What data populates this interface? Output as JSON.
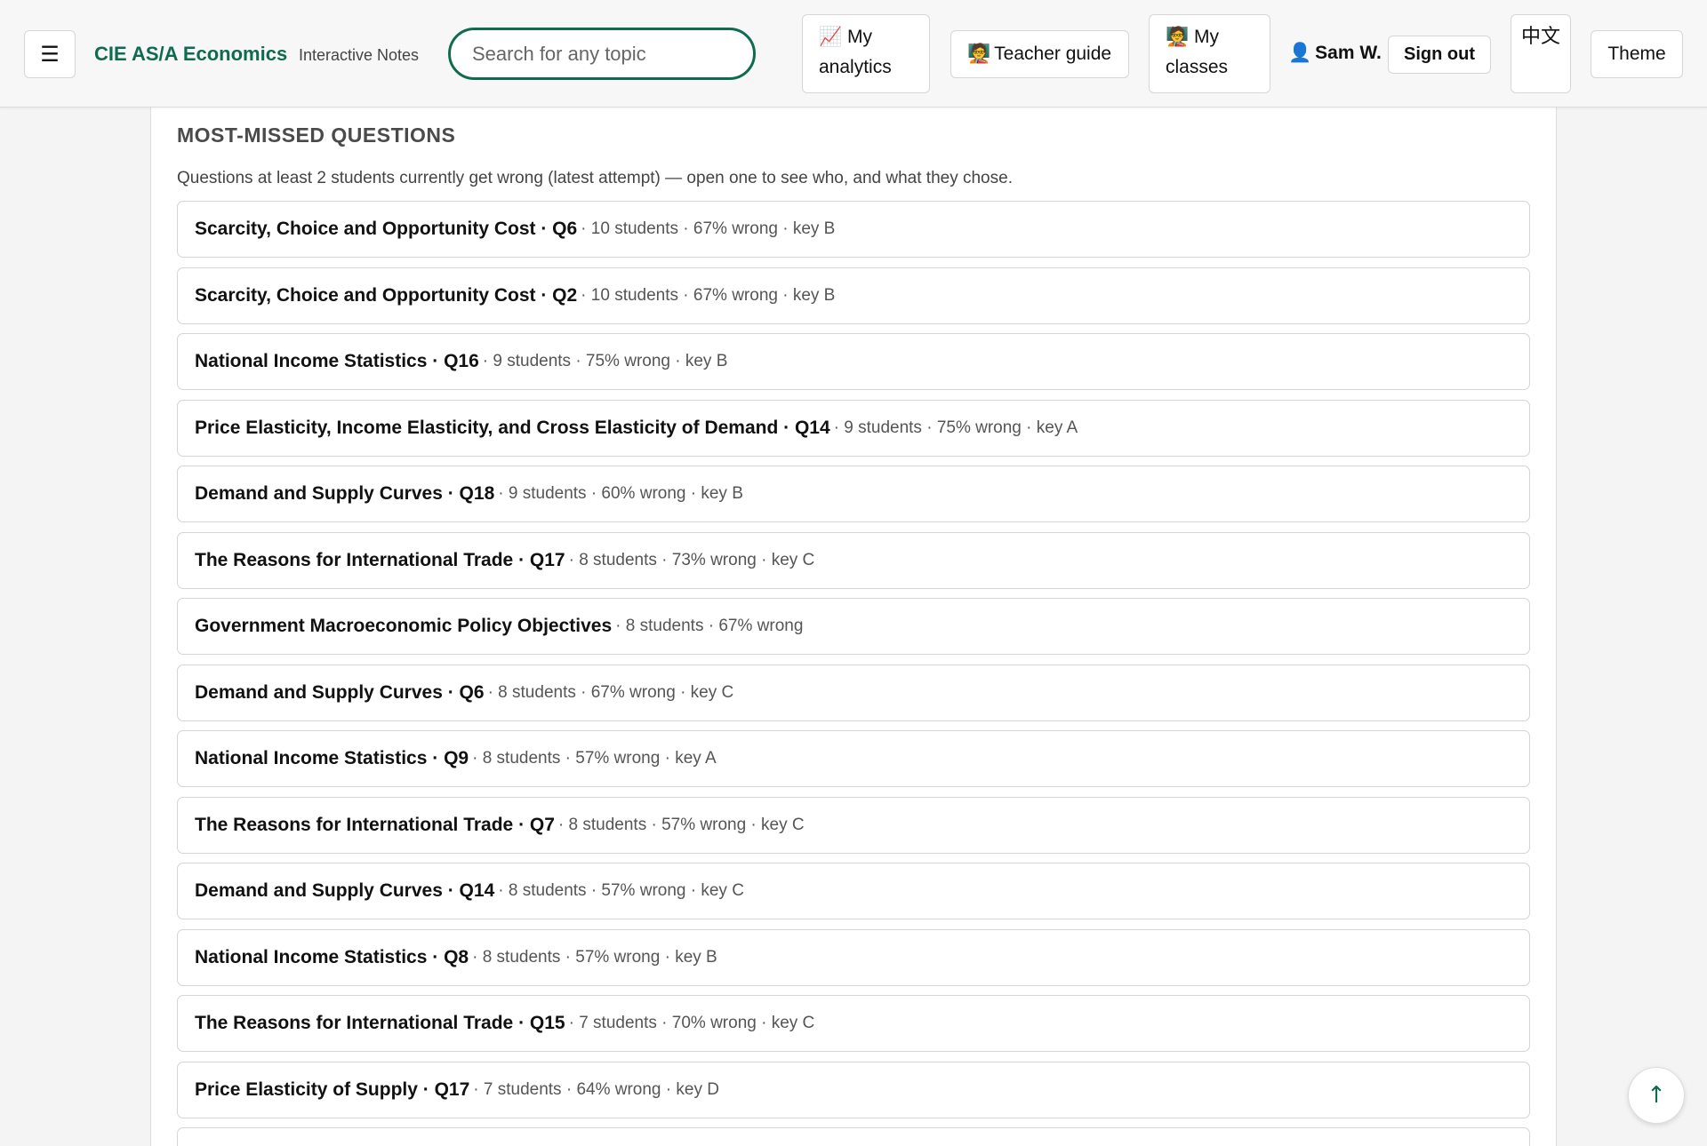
{
  "header": {
    "menu_icon": "☰",
    "brand": "CIE AS/A Economics",
    "brand_sub": "Interactive Notes",
    "search_placeholder": "Search for any topic",
    "analytics_icon": "📈",
    "analytics_label": "My analytics",
    "teacher_icon": "🧑‍🏫",
    "teacher_label": "Teacher guide",
    "classes_icon": "🧑‍🏫",
    "classes_label": "My classes",
    "user_icon": "👤",
    "user_name": "Sam W.",
    "signout_label": "Sign out",
    "lang_label": "中文",
    "theme_label": "Theme",
    "accent_color": "#0f6b4f"
  },
  "section": {
    "title": "MOST-MISSED QUESTIONS",
    "description": "Questions at least 2 students currently get wrong (latest attempt) — open one to see who, and what they chose."
  },
  "questions": [
    {
      "title": "Scarcity, Choice and Opportunity Cost · Q6",
      "meta": "· 10 students · 67% wrong · key B"
    },
    {
      "title": "Scarcity, Choice and Opportunity Cost · Q2",
      "meta": "· 10 students · 67% wrong · key B"
    },
    {
      "title": "National Income Statistics · Q16",
      "meta": "· 9 students · 75% wrong · key B"
    },
    {
      "title": "Price Elasticity, Income Elasticity, and Cross Elasticity of Demand · Q14",
      "meta": "· 9 students · 75% wrong · key A"
    },
    {
      "title": "Demand and Supply Curves · Q18",
      "meta": "· 9 students · 60% wrong · key B"
    },
    {
      "title": "The Reasons for International Trade · Q17",
      "meta": "· 8 students · 73% wrong · key C"
    },
    {
      "title": "Government Macroeconomic Policy Objectives",
      "meta": "· 8 students · 67% wrong"
    },
    {
      "title": "Demand and Supply Curves · Q6",
      "meta": "· 8 students · 67% wrong · key C"
    },
    {
      "title": "National Income Statistics · Q9",
      "meta": "· 8 students · 57% wrong · key A"
    },
    {
      "title": "The Reasons for International Trade · Q7",
      "meta": "· 8 students · 57% wrong · key C"
    },
    {
      "title": "Demand and Supply Curves · Q14",
      "meta": "· 8 students · 57% wrong · key C"
    },
    {
      "title": "National Income Statistics · Q8",
      "meta": "· 8 students · 57% wrong · key B"
    },
    {
      "title": "The Reasons for International Trade · Q15",
      "meta": "· 7 students · 70% wrong · key C"
    },
    {
      "title": "Price Elasticity of Supply · Q17",
      "meta": "· 7 students · 64% wrong · key D"
    },
    {
      "title": "",
      "meta": ""
    }
  ],
  "scroll_top_icon": "↑"
}
